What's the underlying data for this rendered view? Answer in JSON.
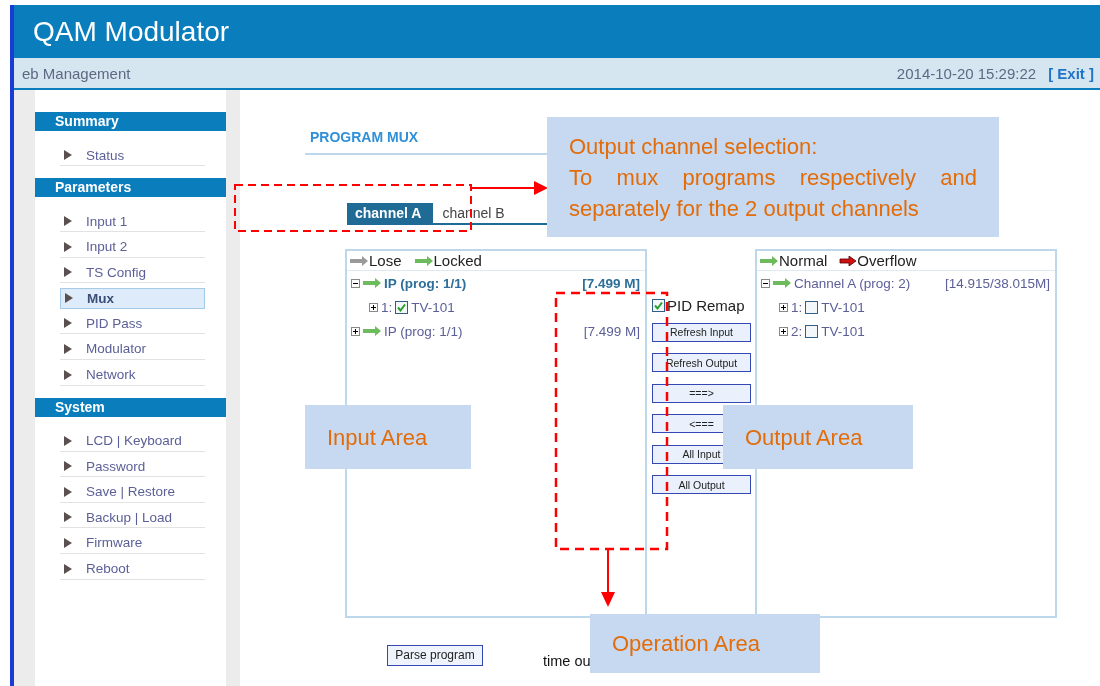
{
  "header": {
    "title": "QAM Modulator",
    "subtitle": "eb Management",
    "datetime": "2014-10-20 15:29:22",
    "exit": "[ Exit ]"
  },
  "sidebar": [
    {
      "title": "Summary",
      "items": [
        {
          "label": "Status",
          "selected": false
        }
      ]
    },
    {
      "title": "Parameters",
      "items": [
        {
          "label": "Input 1",
          "selected": false
        },
        {
          "label": "Input 2",
          "selected": false
        },
        {
          "label": "TS Config",
          "selected": false
        },
        {
          "label": "Mux",
          "selected": true
        },
        {
          "label": "PID Pass",
          "selected": false
        },
        {
          "label": "Modulator",
          "selected": false
        },
        {
          "label": "Network",
          "selected": false
        }
      ]
    },
    {
      "title": "System",
      "items": [
        {
          "label": "LCD | Keyboard",
          "selected": false
        },
        {
          "label": "Password",
          "selected": false
        },
        {
          "label": "Save | Restore",
          "selected": false
        },
        {
          "label": "Backup | Load",
          "selected": false
        },
        {
          "label": "Firmware",
          "selected": false
        },
        {
          "label": "Reboot",
          "selected": false
        }
      ]
    }
  ],
  "page_title": "PROGRAM MUX",
  "tabs": [
    {
      "label": "channel A",
      "selected": true
    },
    {
      "label": "channel B",
      "selected": false
    }
  ],
  "input_panel": {
    "legend": [
      {
        "label": "Lose",
        "kind": "lose"
      },
      {
        "label": "Locked",
        "kind": "locked"
      }
    ],
    "tree": [
      {
        "label": "IP (prog: 1/1)",
        "rate": "[7.499 M]",
        "kind": "locked",
        "expanded": true,
        "selected": true,
        "children": [
          {
            "index": "1:",
            "label": "TV-101",
            "checked": true,
            "expanded": false
          }
        ]
      },
      {
        "label": "IP (prog: 1/1)",
        "rate": "[7.499 M]",
        "kind": "locked",
        "expanded": false,
        "selected": false
      }
    ]
  },
  "operations": {
    "pid_remap": {
      "label": "PID Remap",
      "checked": true
    },
    "buttons": [
      "Refresh Input",
      "Refresh Output",
      "===>",
      "<===",
      "All Input",
      "All Output"
    ]
  },
  "output_panel": {
    "legend": [
      {
        "label": "Normal",
        "kind": "normal"
      },
      {
        "label": "Overflow",
        "kind": "overflow"
      }
    ],
    "tree": [
      {
        "label": "Channel A (prog: 2)",
        "rate": "[14.915/38.015M]",
        "kind": "normal",
        "expanded": true,
        "selected": false,
        "children": [
          {
            "index": "1:",
            "label": "TV-101",
            "checked": false,
            "expanded": false
          },
          {
            "index": "2:",
            "label": "TV-101",
            "checked": false,
            "expanded": false
          }
        ]
      }
    ]
  },
  "footer": {
    "button": "Parse program",
    "status": "time ou"
  },
  "annotations": [
    {
      "kind": "output-channel",
      "title": "Output channel selection:",
      "body": "To mux programs respectively and separately for the 2 output channels"
    },
    {
      "kind": "input-area",
      "title": "Input Area"
    },
    {
      "kind": "output-area",
      "title": "Output Area"
    },
    {
      "kind": "operation-area",
      "title": "Operation Area"
    }
  ]
}
